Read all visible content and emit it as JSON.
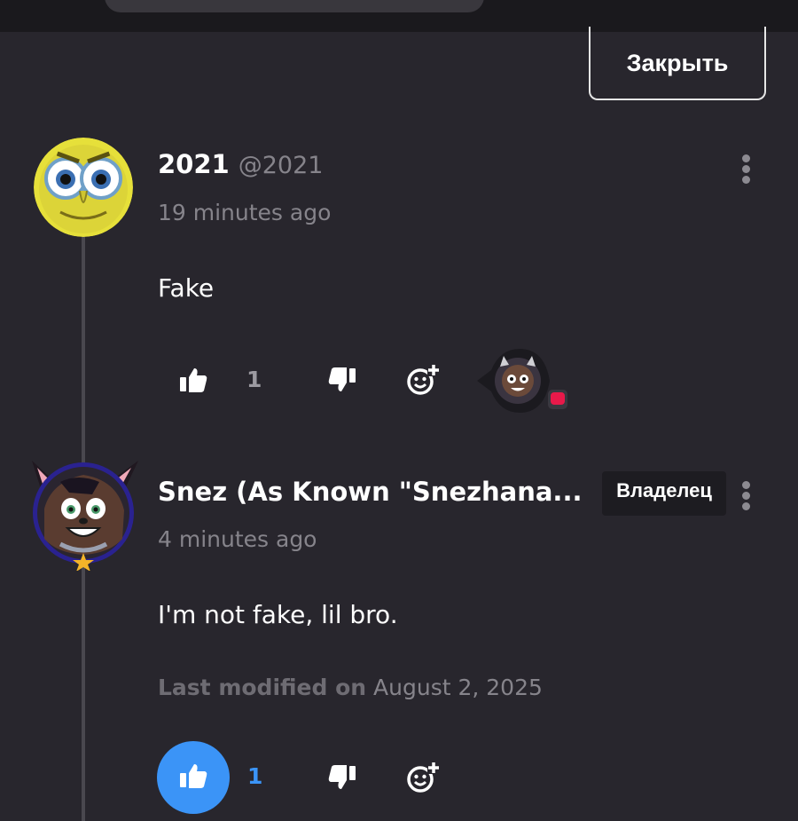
{
  "header": {
    "close_label": "Закрыть"
  },
  "comments": [
    {
      "display_name": "2021",
      "handle": "@2021",
      "time": "19 minutes ago",
      "body": "Fake",
      "like_count": "1",
      "liked": false
    },
    {
      "display_name": "Snez (As Known \"Snezhana...",
      "badge": "Владелец",
      "time": "4 minutes ago",
      "body": "I'm not fake, lil bro.",
      "modified_label": "Last modified on",
      "modified_date": "August 2, 2025",
      "like_count": "1",
      "liked": true
    }
  ],
  "icons": {
    "like": "thumbs-up-icon",
    "dislike": "thumbs-down-icon",
    "reaction": "add-emoji-icon",
    "more": "more-vertical-icon"
  },
  "colors": {
    "background": "#28262d",
    "accent_blue": "#3b94f7",
    "notification_red": "#e8194a"
  }
}
